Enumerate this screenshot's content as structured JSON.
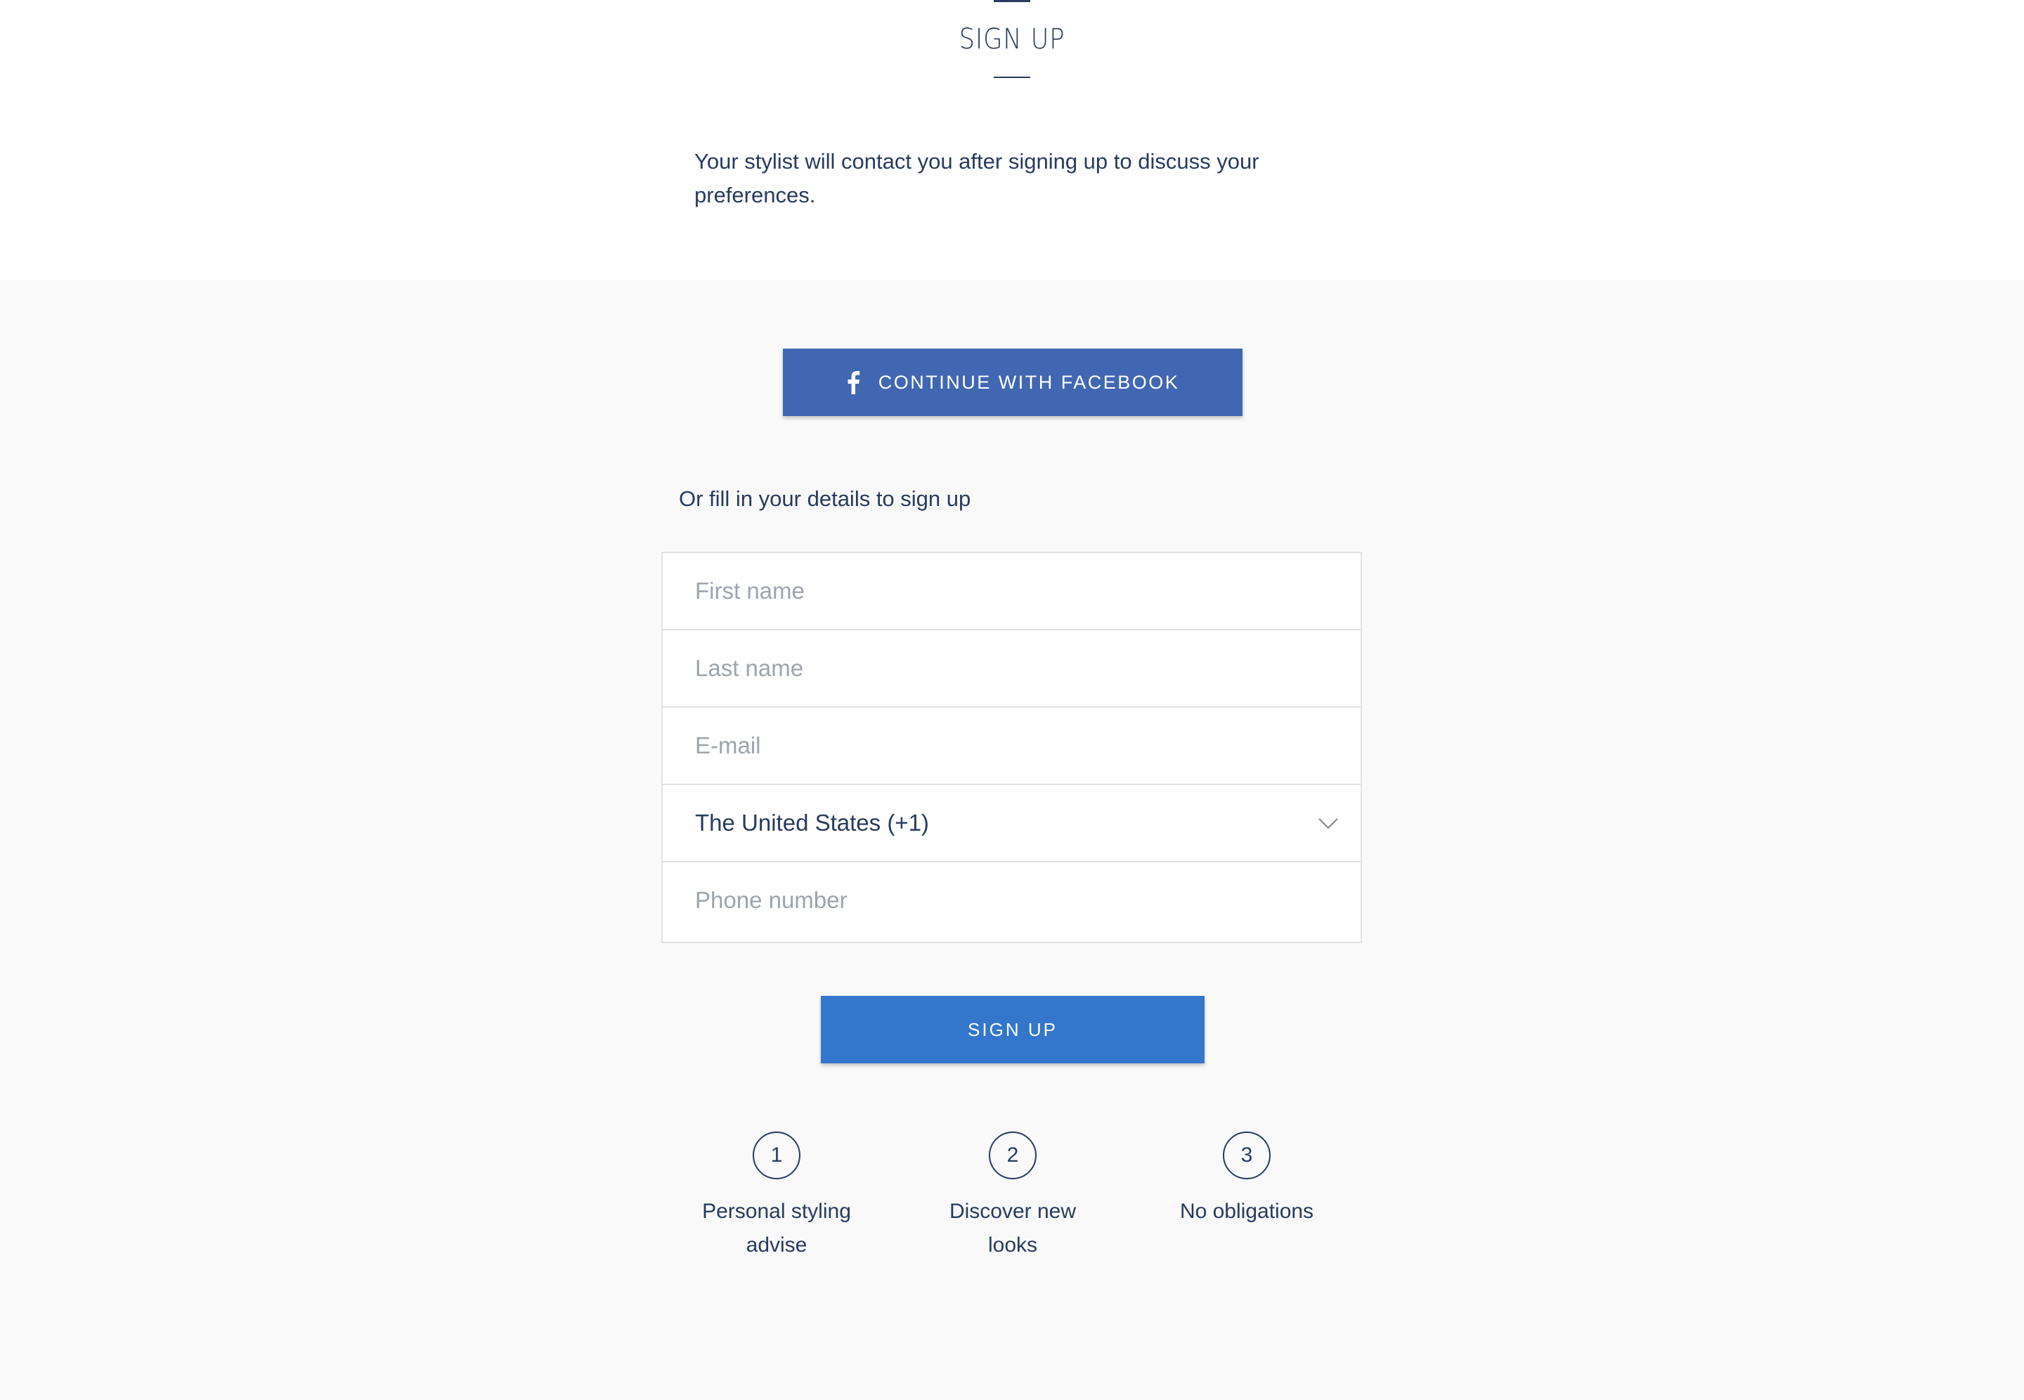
{
  "header": {
    "title": "SIGN UP",
    "intro": "Your stylist will contact you after signing up to discuss your preferences."
  },
  "facebook": {
    "label": "CONTINUE WITH FACEBOOK",
    "icon": "facebook-icon",
    "color": "#4267b2"
  },
  "form": {
    "prompt": "Or fill in your details to sign up",
    "first_name_placeholder": "First name",
    "last_name_placeholder": "Last name",
    "email_placeholder": "E-mail",
    "country_value": "The United States (+1)",
    "phone_placeholder": "Phone number",
    "submit_label": "SIGN UP",
    "submit_color": "#3376cc"
  },
  "steps": [
    {
      "number": "1",
      "label": "Personal styling advise"
    },
    {
      "number": "2",
      "label": "Discover new looks"
    },
    {
      "number": "3",
      "label": "No obligations"
    }
  ],
  "colors": {
    "text": "#283a5e",
    "background_gray": "#f9f9f9"
  }
}
